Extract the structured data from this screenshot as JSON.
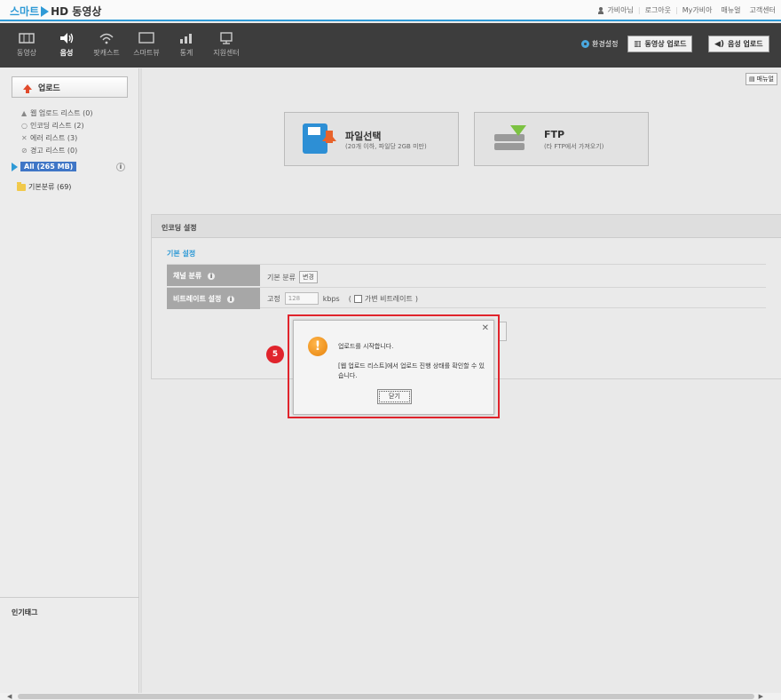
{
  "app": {
    "logo_smart": "스마트",
    "logo_hd": "HD 동영상"
  },
  "toplinks": [
    "가비아님",
    "로그아웃",
    "My가비아",
    "매뉴얼",
    "고객센터"
  ],
  "nav": {
    "items": [
      {
        "label": "동영상",
        "icon": "film-icon"
      },
      {
        "label": "음성",
        "icon": "speaker-icon"
      },
      {
        "label": "팟캐스트",
        "icon": "wifi-icon"
      },
      {
        "label": "스마트뷰",
        "icon": "monitor-icon"
      },
      {
        "label": "통계",
        "icon": "chart-icon"
      },
      {
        "label": "지원센터",
        "icon": "support-icon"
      }
    ],
    "env_setting": "환경설정",
    "video_upload": "동영상 업로드",
    "audio_upload": "음성 업로드"
  },
  "sidebar": {
    "upload": "업로드",
    "lists": [
      "웹 업로드 리스트 (0)",
      "인코딩 리스트 (2)",
      "에러 리스트 (3)",
      "경고 리스트 (0)"
    ],
    "all_label": "All (265 MB)",
    "folder": "기본분류 (69)",
    "popular_tags": "인기태그"
  },
  "main": {
    "manual": "매뉴얼",
    "file_select_title": "파일선택",
    "file_select_sub": "(20개 이하, 파일당 2GB 미만)",
    "ftp_title": "FTP",
    "ftp_sub": "(타 FTP에서 가져오기)",
    "encode_header": "인코딩 설정",
    "basic_title": "기본 설정",
    "category_label": "채널 분류",
    "category_value": "기본 분류",
    "change_btn": "변경",
    "bitrate_label": "비트레이트 설정",
    "bitrate_fixed": "고정",
    "bitrate_value": "128",
    "bitrate_unit": "kbps",
    "bitrate_variable": "가변 비트레이트"
  },
  "dialog": {
    "message1": "업로드를 시작합니다.",
    "message2": "[웹 업로드 리스트]에서 업로드 진행 상태를 확인할 수 있습니다.",
    "close_btn": "닫기",
    "step": "5"
  },
  "colors": {
    "accent": "#2f9ad6",
    "highlight": "#e0242c",
    "nav_bg": "#3d3d3d"
  }
}
